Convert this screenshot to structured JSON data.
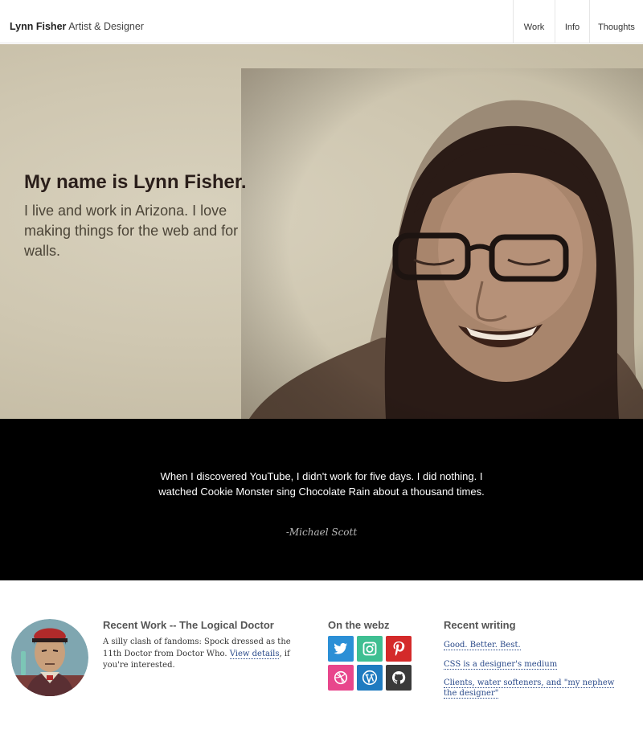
{
  "header": {
    "name": "Lynn Fisher",
    "role": "Artist & Designer",
    "nav": [
      "Work",
      "Info",
      "Thoughts"
    ]
  },
  "hero": {
    "title": "My name is Lynn Fisher.",
    "subtitle": "I live and work in Arizona. I love making things for the web and for walls."
  },
  "quote": {
    "text": "When I discovered YouTube, I didn't work for five days. I did nothing. I watched Cookie Monster sing Chocolate Rain about a thousand times.",
    "author": "-Michael Scott"
  },
  "recent_work": {
    "heading": "Recent Work -- The Logical Doctor",
    "desc_before": "A silly clash of fandoms: Spock dressed as the 11th Doctor from Doctor Who.",
    "link": "View details",
    "desc_after": ", if you're interested."
  },
  "webz": {
    "heading": "On the webz",
    "icons": [
      {
        "name": "twitter-icon",
        "color": "#2b8fd6"
      },
      {
        "name": "instagram-icon",
        "color": "#3fbf92"
      },
      {
        "name": "pinterest-icon",
        "color": "#d42a2a"
      },
      {
        "name": "dribbble-icon",
        "color": "#e8468c"
      },
      {
        "name": "wordpress-icon",
        "color": "#1f7bc0"
      },
      {
        "name": "github-icon",
        "color": "#3a3a3a"
      }
    ]
  },
  "writing": {
    "heading": "Recent writing",
    "posts": [
      "Good. Better. Best.",
      "CSS is a designer's medium",
      "Clients, water softeners, and \"my nephew the designer\""
    ]
  }
}
